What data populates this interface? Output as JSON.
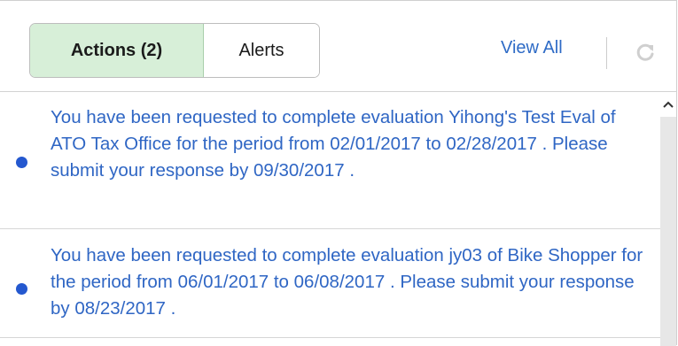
{
  "header": {
    "tabs": [
      {
        "label": "Actions (2)",
        "active": true
      },
      {
        "label": "Alerts",
        "active": false
      }
    ],
    "view_all_label": "View All",
    "refresh_icon": "refresh-icon"
  },
  "notifications": [
    {
      "message": "You have been requested to complete evaluation Yihong's Test Eval of ATO Tax Office for the period from 02/01/2017 to 02/28/2017 . Please submit your response by 09/30/2017 .",
      "unread": true
    },
    {
      "message": "You have been requested to complete evaluation jy03 of Bike Shopper for the period from 06/01/2017 to 06/08/2017 . Please submit your response by 08/23/2017 .",
      "unread": true
    }
  ],
  "colors": {
    "link": "#2f66c4",
    "active_tab_bg": "#d7efd8",
    "unread_dot": "#2458cf"
  }
}
